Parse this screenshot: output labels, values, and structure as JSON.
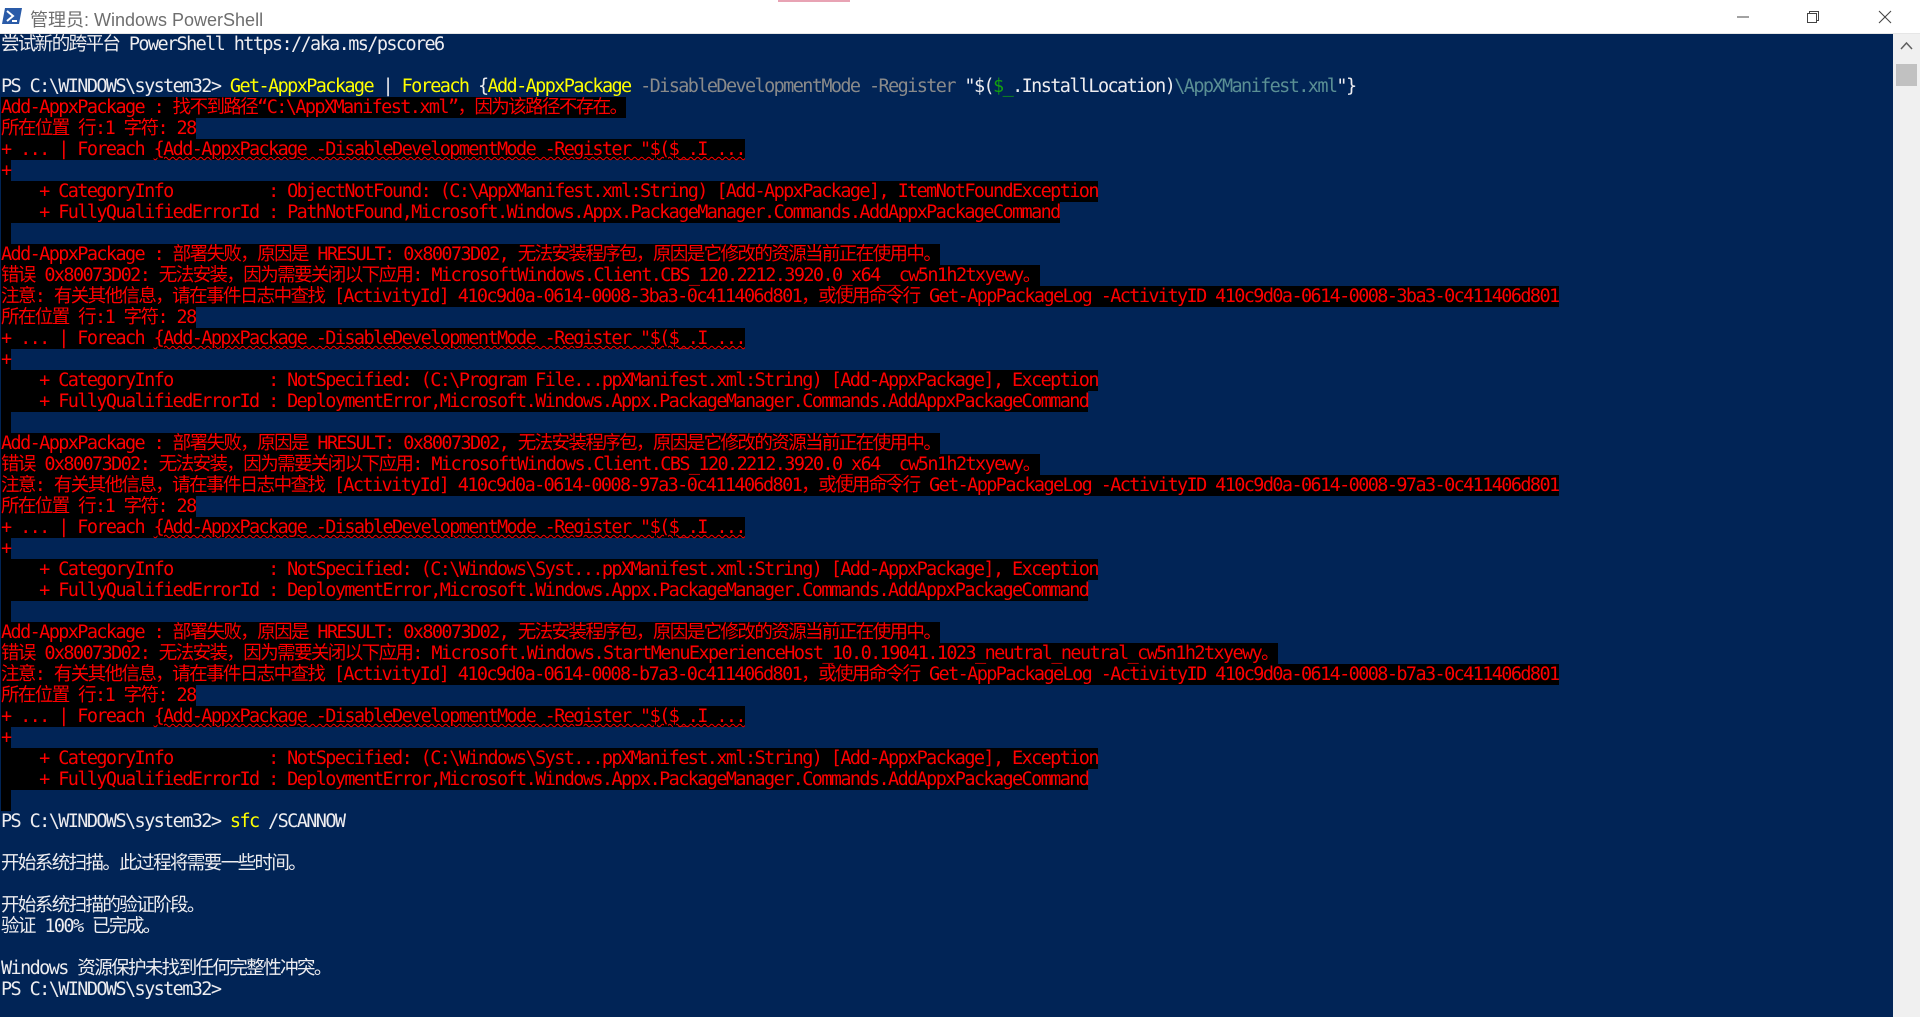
{
  "window": {
    "title": "管理员: Windows PowerShell",
    "icon": "powershell-icon",
    "buttons": [
      "minimize-icon",
      "restore-icon",
      "close-icon"
    ]
  },
  "colors": {
    "console_background": "#012456",
    "text": "#eeedf0",
    "command_yellow": "#ffff00",
    "error_red": "#ff0000",
    "error_background": "#000000"
  },
  "console": {
    "lines": [
      {
        "type": "normal",
        "segments": [
          {
            "text": "尝试新的跨平台 PowerShell https://aka.ms/pscore6",
            "color": "white"
          }
        ]
      },
      {
        "type": "blank",
        "segments": []
      },
      {
        "type": "normal",
        "segments": [
          {
            "text": "PS C:\\WINDOWS\\system32> ",
            "color": "white"
          },
          {
            "text": "Get-AppxPackage",
            "color": "yellow"
          },
          {
            "text": " | ",
            "color": "white"
          },
          {
            "text": "Foreach",
            "color": "yellow"
          },
          {
            "text": " {",
            "color": "white"
          },
          {
            "text": "Add-AppxPackage",
            "color": "yellow"
          },
          {
            "text": " -DisableDevelopmentMode -Register ",
            "color": "gray"
          },
          {
            "text": "\"$(",
            "color": "white"
          },
          {
            "text": "$_",
            "color": "green"
          },
          {
            "text": ".InstallLocation)",
            "color": "white"
          },
          {
            "text": "\\AppXManifest.xml",
            "color": "dim"
          },
          {
            "text": "\"}",
            "color": "white"
          }
        ]
      },
      {
        "type": "error",
        "segments": [
          {
            "text": "Add-AppxPackage : 找不到路径“C:\\AppXManifest.xml”，因为该路径不存在。"
          }
        ]
      },
      {
        "type": "error",
        "segments": [
          {
            "text": "所在位置 行:1 字符: 28"
          }
        ]
      },
      {
        "type": "error",
        "segments": [
          {
            "text": "+ ... | Foreach "
          },
          {
            "text": "{Add-AppxPackage -DisableDevelopmentMode -Register \"$($_.I ...",
            "squig": true
          }
        ]
      },
      {
        "type": "error",
        "segments": [
          {
            "text": "+"
          }
        ]
      },
      {
        "type": "error",
        "segments": [
          {
            "text": "    + CategoryInfo          : ObjectNotFound: (C:\\AppXManifest.xml:String) [Add-AppxPackage], ItemNotFoundException"
          }
        ]
      },
      {
        "type": "error",
        "segments": [
          {
            "text": "    + FullyQualifiedErrorId : PathNotFound,Microsoft.Windows.Appx.PackageManager.Commands.AddAppxPackageCommand"
          }
        ]
      },
      {
        "type": "error",
        "segments": [
          {
            "text": " "
          }
        ]
      },
      {
        "type": "error",
        "segments": [
          {
            "text": "Add-AppxPackage : 部署失败，原因是 HRESULT: 0x80073D02, 无法安装程序包，原因是它修改的资源当前正在使用中。"
          }
        ]
      },
      {
        "type": "error",
        "segments": [
          {
            "text": "错误 0x80073D02: 无法安装，因为需要关闭以下应用: MicrosoftWindows.Client.CBS_120.2212.3920.0_x64__cw5n1h2txyewy。"
          }
        ]
      },
      {
        "type": "error",
        "segments": [
          {
            "text": "注意: 有关其他信息，请在事件日志中查找 [ActivityId] 410c9d0a-0614-0008-3ba3-0c411406d801，或使用命令行 Get-AppPackageLog -ActivityID 410c9d0a-0614-0008-3ba3-0c411406d801"
          }
        ]
      },
      {
        "type": "error",
        "segments": [
          {
            "text": "所在位置 行:1 字符: 28"
          }
        ]
      },
      {
        "type": "error",
        "segments": [
          {
            "text": "+ ... | Foreach "
          },
          {
            "text": "{Add-AppxPackage -DisableDevelopmentMode -Register \"$($_.I ...",
            "squig": true
          }
        ]
      },
      {
        "type": "error",
        "segments": [
          {
            "text": "+"
          }
        ]
      },
      {
        "type": "error",
        "segments": [
          {
            "text": "    + CategoryInfo          : NotSpecified: (C:\\Program File...ppXManifest.xml:String) [Add-AppxPackage], Exception"
          }
        ]
      },
      {
        "type": "error",
        "segments": [
          {
            "text": "    + FullyQualifiedErrorId : DeploymentError,Microsoft.Windows.Appx.PackageManager.Commands.AddAppxPackageCommand"
          }
        ]
      },
      {
        "type": "error",
        "segments": [
          {
            "text": " "
          }
        ]
      },
      {
        "type": "error",
        "segments": [
          {
            "text": "Add-AppxPackage : 部署失败，原因是 HRESULT: 0x80073D02, 无法安装程序包，原因是它修改的资源当前正在使用中。"
          }
        ]
      },
      {
        "type": "error",
        "segments": [
          {
            "text": "错误 0x80073D02: 无法安装，因为需要关闭以下应用: MicrosoftWindows.Client.CBS_120.2212.3920.0_x64__cw5n1h2txyewy。"
          }
        ]
      },
      {
        "type": "error",
        "segments": [
          {
            "text": "注意: 有关其他信息，请在事件日志中查找 [ActivityId] 410c9d0a-0614-0008-97a3-0c411406d801，或使用命令行 Get-AppPackageLog -ActivityID 410c9d0a-0614-0008-97a3-0c411406d801"
          }
        ]
      },
      {
        "type": "error",
        "segments": [
          {
            "text": "所在位置 行:1 字符: 28"
          }
        ]
      },
      {
        "type": "error",
        "segments": [
          {
            "text": "+ ... | Foreach "
          },
          {
            "text": "{Add-AppxPackage -DisableDevelopmentMode -Register \"$($_.I ...",
            "squig": true
          }
        ]
      },
      {
        "type": "error",
        "segments": [
          {
            "text": "+"
          }
        ]
      },
      {
        "type": "error",
        "segments": [
          {
            "text": "    + CategoryInfo          : NotSpecified: (C:\\Windows\\Syst...ppXManifest.xml:String) [Add-AppxPackage], Exception"
          }
        ]
      },
      {
        "type": "error",
        "segments": [
          {
            "text": "    + FullyQualifiedErrorId : DeploymentError,Microsoft.Windows.Appx.PackageManager.Commands.AddAppxPackageCommand"
          }
        ]
      },
      {
        "type": "error",
        "segments": [
          {
            "text": " "
          }
        ]
      },
      {
        "type": "error",
        "segments": [
          {
            "text": "Add-AppxPackage : 部署失败，原因是 HRESULT: 0x80073D02, 无法安装程序包，原因是它修改的资源当前正在使用中。"
          }
        ]
      },
      {
        "type": "error",
        "segments": [
          {
            "text": "错误 0x80073D02: 无法安装，因为需要关闭以下应用: Microsoft.Windows.StartMenuExperienceHost_10.0.19041.1023_neutral_neutral_cw5n1h2txyewy。"
          }
        ]
      },
      {
        "type": "error",
        "segments": [
          {
            "text": "注意: 有关其他信息，请在事件日志中查找 [ActivityId] 410c9d0a-0614-0008-b7a3-0c411406d801，或使用命令行 Get-AppPackageLog -ActivityID 410c9d0a-0614-0008-b7a3-0c411406d801"
          }
        ]
      },
      {
        "type": "error",
        "segments": [
          {
            "text": "所在位置 行:1 字符: 28"
          }
        ]
      },
      {
        "type": "error",
        "segments": [
          {
            "text": "+ ... | Foreach "
          },
          {
            "text": "{Add-AppxPackage -DisableDevelopmentMode -Register \"$($_.I ...",
            "squig": true
          }
        ]
      },
      {
        "type": "error",
        "segments": [
          {
            "text": "+"
          }
        ]
      },
      {
        "type": "error",
        "segments": [
          {
            "text": "    + CategoryInfo          : NotSpecified: (C:\\Windows\\Syst...ppXManifest.xml:String) [Add-AppxPackage], Exception"
          }
        ]
      },
      {
        "type": "error",
        "segments": [
          {
            "text": "    + FullyQualifiedErrorId : DeploymentError,Microsoft.Windows.Appx.PackageManager.Commands.AddAppxPackageCommand"
          }
        ]
      },
      {
        "type": "error",
        "segments": [
          {
            "text": " "
          }
        ]
      },
      {
        "type": "normal",
        "segments": [
          {
            "text": "PS C:\\WINDOWS\\system32> ",
            "color": "white"
          },
          {
            "text": "sfc",
            "color": "yellow"
          },
          {
            "text": " /SCANNOW",
            "color": "white"
          }
        ]
      },
      {
        "type": "blank",
        "segments": []
      },
      {
        "type": "normal",
        "segments": [
          {
            "text": "开始系统扫描。此过程将需要一些时间。",
            "color": "white"
          }
        ]
      },
      {
        "type": "blank",
        "segments": []
      },
      {
        "type": "normal",
        "segments": [
          {
            "text": "开始系统扫描的验证阶段。",
            "color": "white"
          }
        ]
      },
      {
        "type": "normal",
        "segments": [
          {
            "text": "验证 100% 已完成。",
            "color": "white"
          }
        ]
      },
      {
        "type": "blank",
        "segments": []
      },
      {
        "type": "normal",
        "segments": [
          {
            "text": "Windows 资源保护未找到任何完整性冲突。",
            "color": "white"
          }
        ]
      },
      {
        "type": "normal",
        "segments": [
          {
            "text": "PS C:\\WINDOWS\\system32>",
            "color": "white"
          }
        ]
      }
    ]
  }
}
